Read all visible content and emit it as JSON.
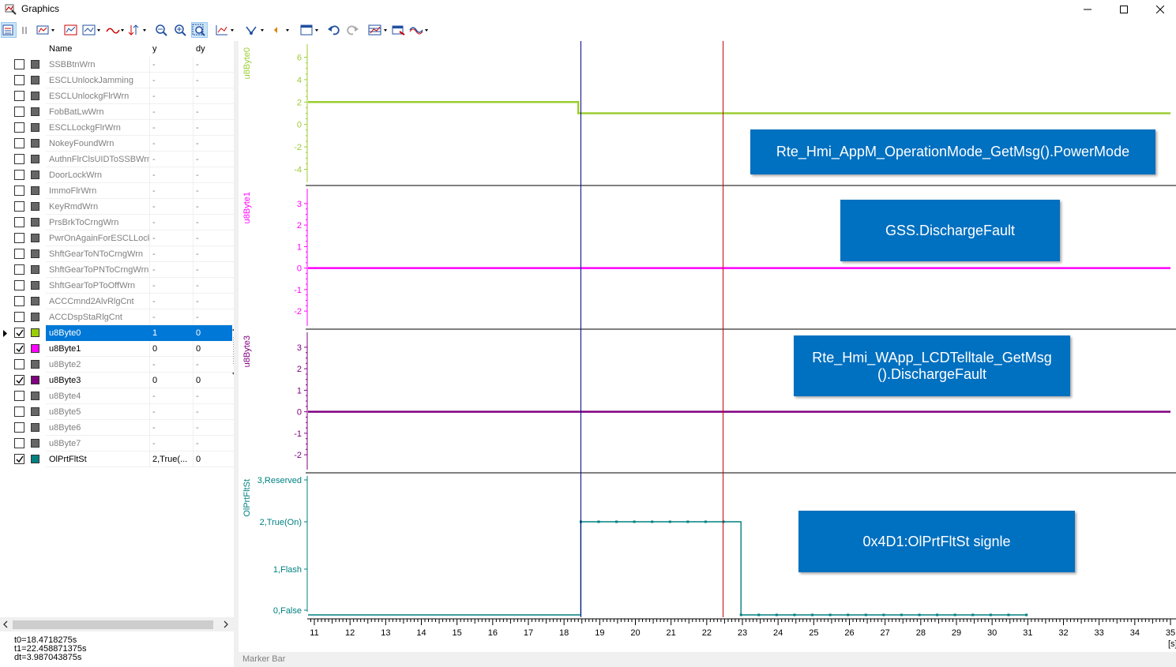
{
  "window": {
    "title": "Graphics"
  },
  "table": {
    "headers": {
      "name": "Name",
      "y": "y",
      "dy": "dy"
    },
    "rows": [
      {
        "name": "SSBBtnWrn",
        "y": "-",
        "dy": "-",
        "checked": false,
        "color": "#666666",
        "gray": true
      },
      {
        "name": "ESCLUnlockJamming",
        "y": "-",
        "dy": "-",
        "checked": false,
        "color": "#666666",
        "gray": true
      },
      {
        "name": "ESCLUnlockgFlrWrn",
        "y": "-",
        "dy": "-",
        "checked": false,
        "color": "#666666",
        "gray": true
      },
      {
        "name": "FobBatLwWrn",
        "y": "-",
        "dy": "-",
        "checked": false,
        "color": "#666666",
        "gray": true
      },
      {
        "name": "ESCLLockgFlrWrn",
        "y": "-",
        "dy": "-",
        "checked": false,
        "color": "#666666",
        "gray": true
      },
      {
        "name": "NokeyFoundWrn",
        "y": "-",
        "dy": "-",
        "checked": false,
        "color": "#666666",
        "gray": true
      },
      {
        "name": "AuthnFlrClsUIDToSSBWrn",
        "y": "-",
        "dy": "-",
        "checked": false,
        "color": "#666666",
        "gray": true
      },
      {
        "name": "DoorLockWrn",
        "y": "-",
        "dy": "-",
        "checked": false,
        "color": "#666666",
        "gray": true
      },
      {
        "name": "ImmoFlrWrn",
        "y": "-",
        "dy": "-",
        "checked": false,
        "color": "#666666",
        "gray": true
      },
      {
        "name": "KeyRmdWrn",
        "y": "-",
        "dy": "-",
        "checked": false,
        "color": "#666666",
        "gray": true
      },
      {
        "name": "PrsBrkToCrngWrn",
        "y": "-",
        "dy": "-",
        "checked": false,
        "color": "#666666",
        "gray": true
      },
      {
        "name": "PwrOnAgainForESCLLocking",
        "y": "-",
        "dy": "-",
        "checked": false,
        "color": "#666666",
        "gray": true
      },
      {
        "name": "ShftGearToNToCrngWrn",
        "y": "-",
        "dy": "-",
        "checked": false,
        "color": "#666666",
        "gray": true
      },
      {
        "name": "ShftGearToPNToCrngWrn",
        "y": "-",
        "dy": "-",
        "checked": false,
        "color": "#666666",
        "gray": true
      },
      {
        "name": "ShftGearToPToOffWrn",
        "y": "-",
        "dy": "-",
        "checked": false,
        "color": "#666666",
        "gray": true
      },
      {
        "name": "ACCCmnd2AlvRlgCnt",
        "y": "-",
        "dy": "-",
        "checked": false,
        "color": "#666666",
        "gray": true
      },
      {
        "name": "ACCDspStaRlgCnt",
        "y": "-",
        "dy": "-",
        "checked": false,
        "color": "#666666",
        "gray": true
      },
      {
        "name": "u8Byte0",
        "y": "1",
        "dy": "0",
        "checked": true,
        "color": "#9acd00",
        "gray": false,
        "selected": true
      },
      {
        "name": "u8Byte1",
        "y": "0",
        "dy": "0",
        "checked": true,
        "color": "#ff00ff",
        "gray": false
      },
      {
        "name": "u8Byte2",
        "y": "-",
        "dy": "-",
        "checked": false,
        "color": "#666666",
        "gray": true
      },
      {
        "name": "u8Byte3",
        "y": "0",
        "dy": "0",
        "checked": true,
        "color": "#800080",
        "gray": false
      },
      {
        "name": "u8Byte4",
        "y": "-",
        "dy": "-",
        "checked": false,
        "color": "#666666",
        "gray": true
      },
      {
        "name": "u8Byte5",
        "y": "-",
        "dy": "-",
        "checked": false,
        "color": "#666666",
        "gray": true
      },
      {
        "name": "u8Byte6",
        "y": "-",
        "dy": "-",
        "checked": false,
        "color": "#666666",
        "gray": true
      },
      {
        "name": "u8Byte7",
        "y": "-",
        "dy": "-",
        "checked": false,
        "color": "#666666",
        "gray": true
      },
      {
        "name": "OlPrtFltSt",
        "y": "2,True(...",
        "dy": "0",
        "checked": true,
        "color": "#008080",
        "gray": false
      }
    ]
  },
  "markers": {
    "t0": "t0=18.4718275s",
    "t1": "t1=22.458871375s",
    "dt": "dt=3.987043875s"
  },
  "marker_bar_label": "Marker Bar",
  "callouts": {
    "power_mode": "Rte_Hmi_AppM_OperationMode_GetMsg().PowerMode",
    "gss": "GSS.DischargeFault",
    "lcd": "Rte_Hmi_WApp_LCDTelltale_GetMsg ().DischargeFault",
    "signal": "0x4D1:OlPrtFltSt signle"
  },
  "chart_data": {
    "type": "line",
    "xlabel": "[s]",
    "xlim": [
      10.8,
      35
    ],
    "x_ticks": [
      "11",
      "12",
      "13",
      "14",
      "15",
      "16",
      "17",
      "18",
      "19",
      "20",
      "21",
      "22",
      "23",
      "24",
      "25",
      "26",
      "27",
      "28",
      "29",
      "30",
      "31",
      "32",
      "33",
      "34",
      "35"
    ],
    "cursors": {
      "t0": 18.4718275,
      "t1": 22.458871375,
      "t0_color": "#00008b",
      "t1_color": "#c00000"
    },
    "panels": [
      {
        "name": "u8Byte0",
        "color": "#9acd32",
        "ylim": [
          -4.6,
          6.6
        ],
        "y_ticks": [
          "6",
          "4",
          "2",
          "0",
          "-2",
          "-4"
        ],
        "series": [
          {
            "x": [
              10.8,
              18.4,
              18.4,
              35
            ],
            "y": [
              2,
              2,
              1,
              1
            ]
          }
        ]
      },
      {
        "name": "u8Byte1",
        "color": "#ff00ff",
        "ylim": [
          -2.4,
          3.4
        ],
        "y_ticks": [
          "3",
          "2",
          "1",
          "0",
          "-1",
          "-2"
        ],
        "series": [
          {
            "x": [
              10.8,
              35
            ],
            "y": [
              0,
              0
            ]
          }
        ]
      },
      {
        "name": "u8Byte3",
        "color": "#800080",
        "ylim": [
          -2.4,
          3.4
        ],
        "y_ticks": [
          "3",
          "2",
          "1",
          "0",
          "-1",
          "-2"
        ],
        "series": [
          {
            "x": [
              10.8,
              35
            ],
            "y": [
              0,
              0
            ]
          }
        ]
      },
      {
        "name": "OlPrtFltSt",
        "color": "#008080",
        "ylim": [
          -0.1,
          3.1
        ],
        "y_ticks": [
          "3,Reserved",
          "2,True(On)",
          "1,Flash",
          "0,False"
        ],
        "series": [
          {
            "x": [
              10.8,
              18.47,
              18.47,
              22.96,
              22.96,
              31.0
            ],
            "y": [
              -0.1,
              -0.1,
              2,
              2,
              -0.1,
              -0.1
            ]
          }
        ],
        "sample_points_x": [
          18.47,
          18.97,
          19.47,
          19.97,
          20.47,
          20.97,
          21.47,
          21.97,
          22.47,
          22.96,
          23.46,
          23.96,
          24.46,
          24.96,
          25.46,
          25.96,
          26.46,
          26.96,
          27.46,
          27.96,
          28.46,
          28.96,
          29.46,
          29.96,
          30.46,
          30.96
        ]
      }
    ]
  }
}
